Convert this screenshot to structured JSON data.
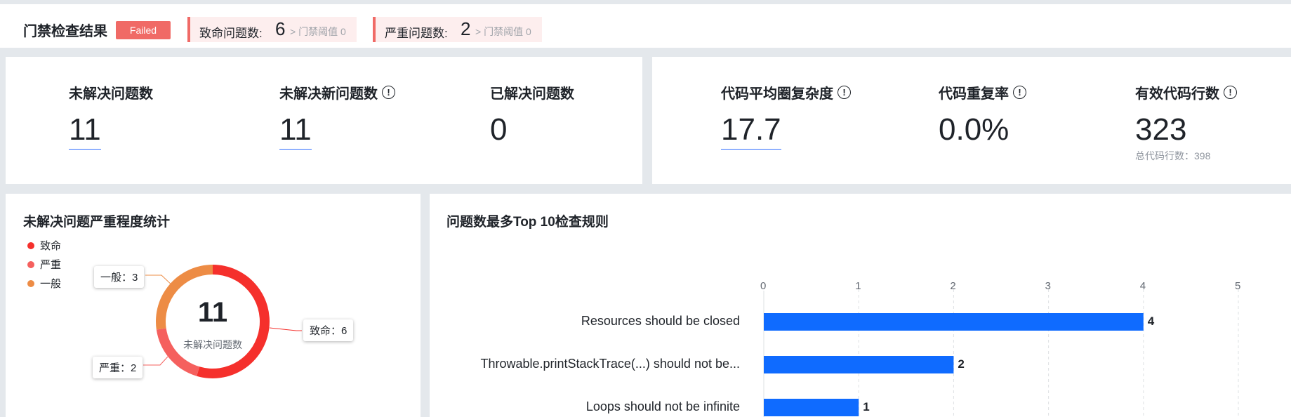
{
  "gate": {
    "title": "门禁检查结果",
    "status": "Failed",
    "fatal": {
      "label": "致命问题数:",
      "value": "6",
      "threshold": "> 门禁阈值 0"
    },
    "serious": {
      "label": "严重问题数:",
      "value": "2",
      "threshold": "> 门禁阈值 0"
    }
  },
  "metrics_left": [
    {
      "label": "未解决问题数",
      "value": "11",
      "has_info": false,
      "underline": true
    },
    {
      "label": "未解决新问题数",
      "value": "11",
      "has_info": true,
      "underline": true
    },
    {
      "label": "已解决问题数",
      "value": "0",
      "has_info": false,
      "underline": false
    }
  ],
  "metrics_right": [
    {
      "label": "代码平均圈复杂度",
      "value": "17.7",
      "has_info": true,
      "underline": true
    },
    {
      "label": "代码重复率",
      "value": "0.0%",
      "has_info": true,
      "underline": false
    },
    {
      "label": "有效代码行数",
      "value": "323",
      "has_info": true,
      "underline": false,
      "sub": "总代码行数：398"
    }
  ],
  "info_glyph": "!",
  "severity": {
    "title": "未解决问题严重程度统计",
    "center_value": "11",
    "center_label": "未解决问题数",
    "legend": [
      {
        "name": "致命",
        "color": "#f5302c"
      },
      {
        "name": "严重",
        "color": "#f5605e"
      },
      {
        "name": "一般",
        "color": "#ed8c45"
      }
    ],
    "callouts": {
      "fatal": "致命：6",
      "serious": "严重：2",
      "general": "一般：3"
    }
  },
  "top_rules": {
    "title": "问题数最多Top 10检查规则",
    "bar_color": "#0f6bff"
  },
  "chart_data": [
    {
      "type": "pie",
      "title": "未解决问题严重程度统计",
      "categories": [
        "致命",
        "严重",
        "一般"
      ],
      "values": [
        6,
        2,
        3
      ],
      "colors": [
        "#f5302c",
        "#f5605e",
        "#ed8c45"
      ],
      "legend": "top-left"
    },
    {
      "type": "bar",
      "orientation": "horizontal",
      "title": "问题数最多Top 10检查规则",
      "categories": [
        "Resources should be closed",
        "Throwable.printStackTrace(...) should not be...",
        "Loops should not be infinite"
      ],
      "values": [
        4,
        2,
        1
      ],
      "xlim": [
        0,
        5
      ],
      "xticks": [
        "0",
        "1",
        "2",
        "3",
        "4",
        "5"
      ],
      "grid": true
    }
  ]
}
